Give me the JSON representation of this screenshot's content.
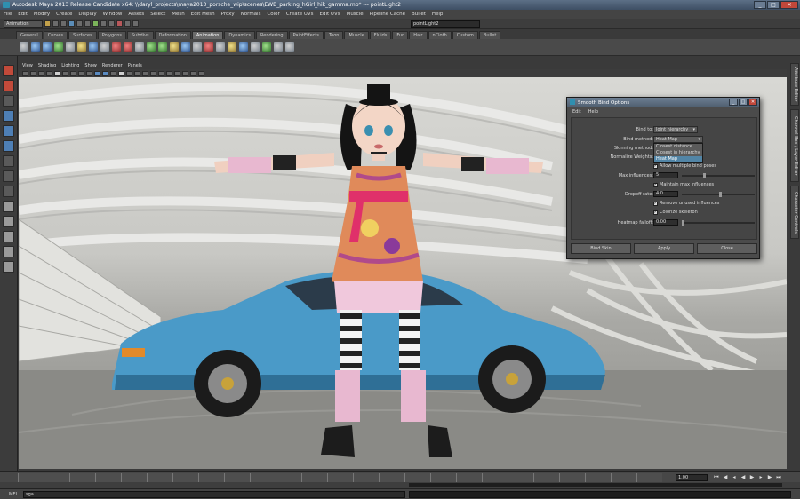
{
  "window": {
    "title": "Autodesk Maya 2013 Release Candidate x64: \\\\daryl_projects\\maya2013_porsche_wip\\scenes\\EWB_parking_hGirl_hik_gamma.mb*    ---    pointLight2",
    "min": "_",
    "max": "□",
    "close": "✕"
  },
  "menubar": [
    "File",
    "Edit",
    "Modify",
    "Create",
    "Display",
    "Window",
    "Assets",
    "Select",
    "Mesh",
    "Edit Mesh",
    "Proxy",
    "Normals",
    "Color",
    "Create UVs",
    "Edit UVs",
    "Muscle",
    "Pipeline Cache",
    "Bullet",
    "Help"
  ],
  "statusline": {
    "mode": "Animation",
    "object_name": "pointLight2"
  },
  "shelf_tabs": [
    "General",
    "Curves",
    "Surfaces",
    "Polygons",
    "Subdivs",
    "Deformation",
    "Animation",
    "Dynamics",
    "Rendering",
    "PaintEffects",
    "Toon",
    "Muscle",
    "Fluids",
    "Fur",
    "Hair",
    "nCloth",
    "Custom",
    "Bullet"
  ],
  "active_shelf_tab": "Animation",
  "panel_menu": [
    "View",
    "Shading",
    "Lighting",
    "Show",
    "Renderer",
    "Panels"
  ],
  "right_tabs": [
    "Attribute Editor",
    "Channel Box / Layer Editor",
    "Character Controls"
  ],
  "dialog": {
    "title": "Smooth Bind Options",
    "menu": [
      "Edit",
      "Help"
    ],
    "bind_to_label": "Bind to:",
    "bind_to_value": "Joint hierarchy",
    "bind_method_label": "Bind method:",
    "bind_method_value": "Heat Map",
    "skinning_method_label": "Skinning method:",
    "normalize_weights_label": "Normalize Weights:",
    "bind_method_options": [
      "Closest distance",
      "Closest in hierarchy",
      "Heat Map"
    ],
    "allow_multiple_label": "Allow multiple bind poses",
    "max_influences_label": "Max influences:",
    "max_influences_value": "5",
    "maintain_max_label": "Maintain max influences",
    "dropoff_label": "Dropoff rate:",
    "dropoff_value": "4.0",
    "remove_unused_label": "Remove unused influences",
    "colorize_label": "Colorize skeleton",
    "heatmap_label": "Heatmap falloff:",
    "heatmap_value": "0.00",
    "bind_skin_button": "Bind Skin",
    "apply_button": "Apply",
    "close_button": "Close"
  },
  "timeline": {
    "current_frame": "1.00"
  },
  "command_line": {
    "label": "MEL",
    "value": "sga"
  }
}
